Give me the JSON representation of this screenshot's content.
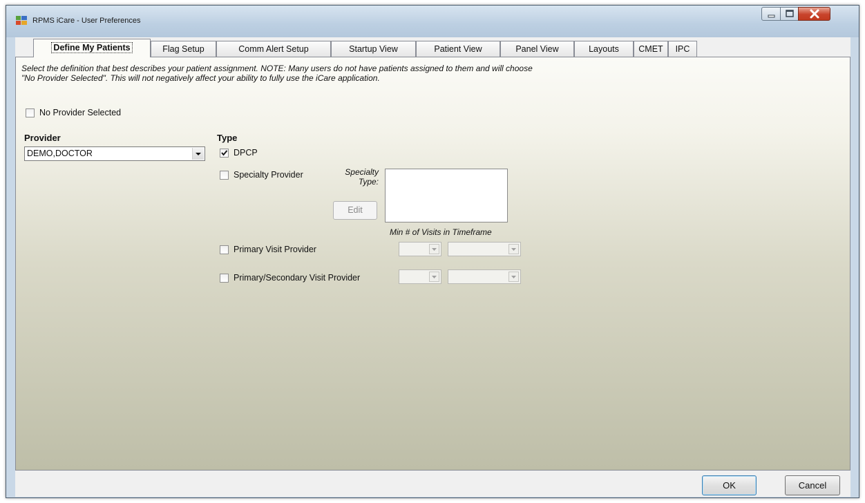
{
  "window": {
    "title": "RPMS iCare - User Preferences",
    "controls": {
      "minimize": "minimize",
      "maximize": "maximize",
      "close": "close"
    }
  },
  "tabs": [
    {
      "label": "Define My Patients",
      "active": true
    },
    {
      "label": "Flag Setup"
    },
    {
      "label": "Comm Alert Setup"
    },
    {
      "label": "Startup View"
    },
    {
      "label": "Patient View"
    },
    {
      "label": "Panel View"
    },
    {
      "label": "Layouts"
    },
    {
      "label": "CMET"
    },
    {
      "label": "IPC"
    }
  ],
  "define": {
    "note_line1": "Select the definition that best describes your patient assignment. NOTE:  Many users do not have patients assigned to them and will choose",
    "note_line2": "\"No Provider Selected\".  This will not negatively affect your ability to fully use the iCare application.",
    "no_provider_label": "No Provider Selected",
    "no_provider_checked": false,
    "provider_heading": "Provider",
    "provider_value": "DEMO,DOCTOR",
    "type_heading": "Type",
    "dpcp_label": "DPCP",
    "dpcp_checked": true,
    "specialty_label": "Specialty Provider",
    "specialty_checked": false,
    "specialty_type_label_line1": "Specialty",
    "specialty_type_label_line2": "Type:",
    "edit_label": "Edit",
    "min_visits_label": "Min # of Visits in Timeframe",
    "primary_visit_label": "Primary Visit Provider",
    "primary_visit_checked": false,
    "primary_secondary_label": "Primary/Secondary Visit Provider",
    "primary_secondary_checked": false
  },
  "footer": {
    "ok_label": "OK",
    "cancel_label": "Cancel"
  },
  "colors": {
    "accent_border": "#3c7fb1",
    "close_button": "#c8432b"
  }
}
